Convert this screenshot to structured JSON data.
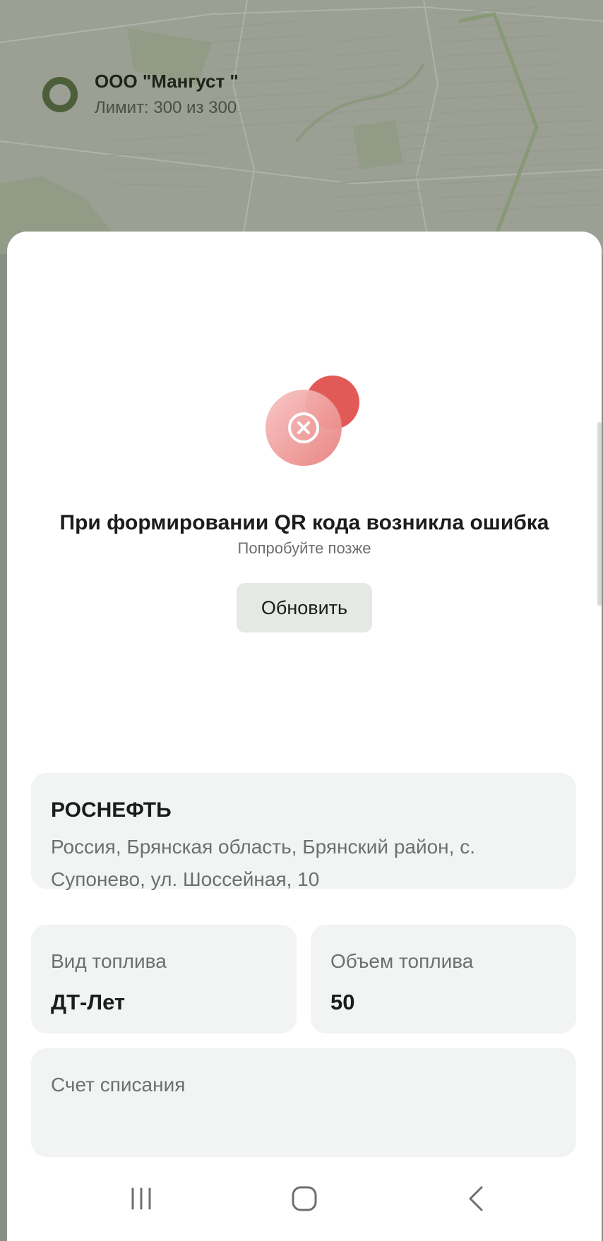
{
  "company": {
    "name": "ООО \"Мангуст \"",
    "limit": "Лимит: 300 из 300"
  },
  "error": {
    "title": "При формировании QR кода возникла ошибка",
    "subtitle": "Попробуйте позже",
    "refresh_label": "Обновить"
  },
  "station": {
    "name": "РОСНЕФТЬ",
    "address": "Россия, Брянская область, Брянский район, с. Супонево, ул. Шоссейная, 10"
  },
  "fuel_type": {
    "label": "Вид топлива",
    "value": "ДТ-Лет"
  },
  "fuel_volume": {
    "label": "Объем топлива",
    "value": "50"
  },
  "account": {
    "label": "Счет списания",
    "value": ""
  },
  "navbar": {
    "icons": [
      "recent-apps-icon",
      "home-icon",
      "back-icon"
    ]
  },
  "colors": {
    "accent_error": "#e25a57",
    "card_bg": "#f2f4f3",
    "map_ring": "#4d5e3a"
  }
}
